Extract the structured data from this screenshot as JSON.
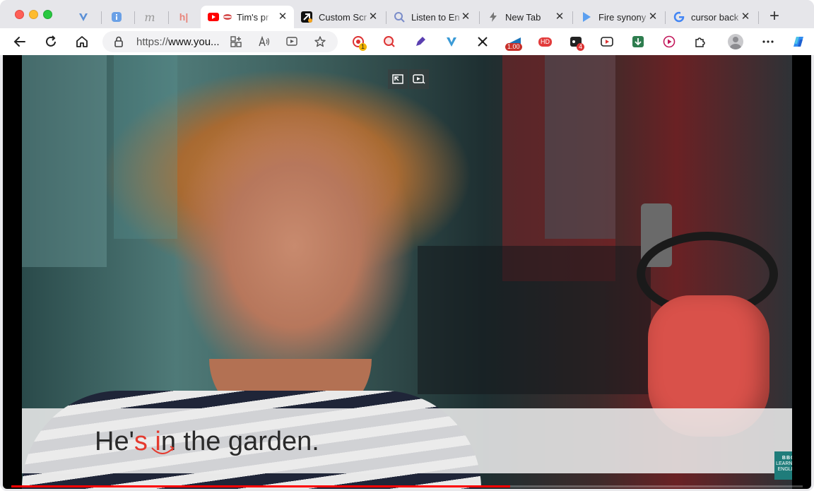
{
  "browser": {
    "tabs": [
      {
        "title": "",
        "icon": "vee-icon",
        "active": false
      },
      {
        "title": "",
        "icon": "info-icon",
        "active": false
      },
      {
        "title": "",
        "icon": "m-letter-icon",
        "active": false
      },
      {
        "title": "",
        "icon": "hj-icon",
        "active": false
      },
      {
        "title": "Tim's pr",
        "icon": "youtube-icon",
        "active": true
      },
      {
        "title": "Custom Scr",
        "icon": "arrow-icon",
        "active": false
      },
      {
        "title": "Listen to En",
        "icon": "search-icon",
        "active": false
      },
      {
        "title": "New Tab",
        "icon": "bolt-icon",
        "active": false
      },
      {
        "title": "Fire synony",
        "icon": "play-icon",
        "active": false
      },
      {
        "title": "cursor back",
        "icon": "google-icon",
        "active": false
      }
    ],
    "address_bar": {
      "scheme": "https://",
      "host": "www.you..."
    },
    "extensions": [
      {
        "name": "record-icon",
        "badge": "1"
      },
      {
        "name": "search-ext-icon",
        "badge": ""
      },
      {
        "name": "note-icon",
        "badge": ""
      },
      {
        "name": "vee-ext-icon",
        "badge": ""
      },
      {
        "name": "shuffle-icon",
        "badge": ""
      },
      {
        "name": "speed-icon",
        "badge": "1.00"
      },
      {
        "name": "hd-icon",
        "badge": "HD"
      },
      {
        "name": "dots-ext-icon",
        "badge": "4"
      },
      {
        "name": "video-ext-icon",
        "badge": ""
      },
      {
        "name": "download-icon",
        "badge": ""
      },
      {
        "name": "play-ext-icon",
        "badge": ""
      },
      {
        "name": "puzzle-icon",
        "badge": ""
      }
    ],
    "colors": {
      "accent": "#1a73e8",
      "youtube_red": "#ff0000",
      "caption_highlight": "#e53a2e"
    }
  },
  "video": {
    "caption": {
      "part1": "He'",
      "part2": "s",
      "part3": " ",
      "part4": "i",
      "part5": "n the garden."
    },
    "logo": {
      "line1": "BBC",
      "line2": "LEARNING",
      "line3": "ENGLISH"
    },
    "info_glyph": "i",
    "progress": 0.63
  }
}
